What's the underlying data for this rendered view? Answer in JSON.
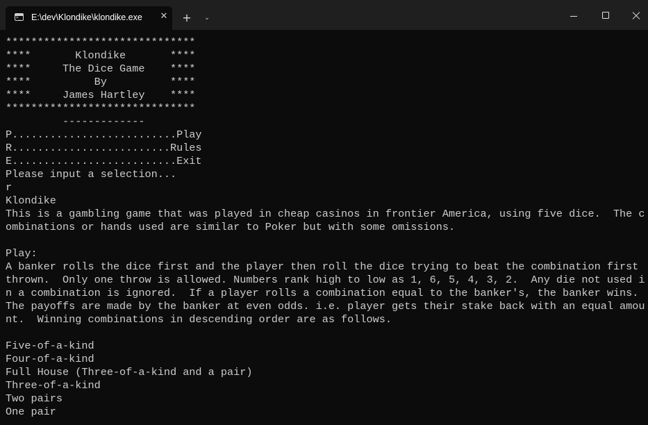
{
  "window": {
    "tab_title": "E:\\dev\\Klondike\\klondike.exe",
    "tab_close_glyph": "✕",
    "new_tab_glyph": "+",
    "dropdown_glyph": "⌄",
    "icons": [
      "terminal-icon",
      "close-icon",
      "plus-icon",
      "chevron-down-icon",
      "minimize-icon",
      "maximize-icon",
      "close-window-icon"
    ]
  },
  "console": {
    "lines": [
      "******************************",
      "****       Klondike       ****",
      "****     The Dice Game    ****",
      "****          By          ****",
      "****     James Hartley    ****",
      "******************************",
      "         -------------",
      "P..........................Play",
      "R.........................Rules",
      "E..........................Exit",
      "Please input a selection...",
      "r",
      "Klondike",
      "This is a gambling game that was played in cheap casinos in frontier America, using five dice.  The c",
      "ombinations or hands used are similar to Poker but with some omissions.",
      "",
      "Play:",
      "A banker rolls the dice first and the player then roll the dice trying to beat the combination first",
      "thrown.  Only one throw is allowed. Numbers rank high to low as 1, 6, 5, 4, 3, 2.  Any die not used i",
      "n a combination is ignored.  If a player rolls a combination equal to the banker's, the banker wins.",
      "The payoffs are made by the banker at even odds. i.e. player gets their stake back with an equal amou",
      "nt.  Winning combinations in descending order are as follows.",
      "",
      "Five-of-a-kind",
      "Four-of-a-kind",
      "Full House (Three-of-a-kind and a pair)",
      "Three-of-a-kind",
      "Two pairs",
      "One pair"
    ]
  },
  "colors": {
    "background": "#0c0c0c",
    "titlebar": "#1f1f1f",
    "text": "#cccccc"
  }
}
